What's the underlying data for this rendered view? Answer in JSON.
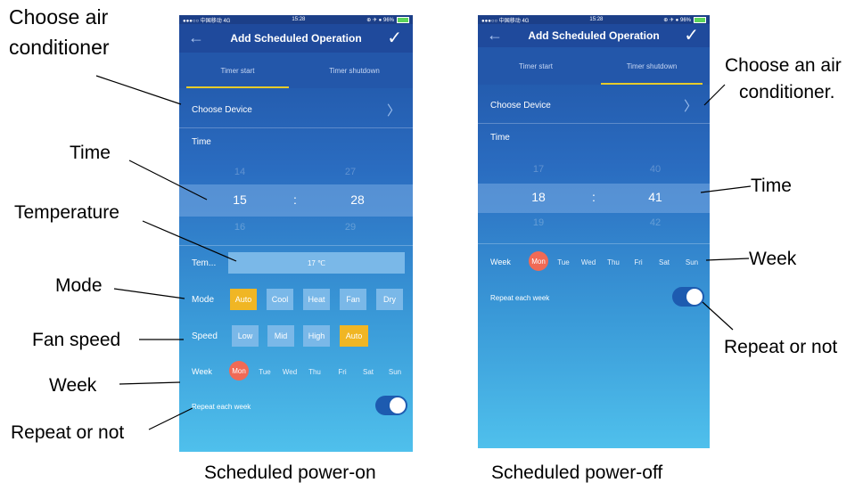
{
  "annotations": {
    "choose_left": "Choose air conditioner",
    "choose_left_l1": "Choose air",
    "choose_left_l2": "conditioner",
    "time_left": "Time",
    "temperature_left": "Temperature",
    "mode_left": "Mode",
    "fan_speed_left": "Fan speed",
    "week_left": "Week",
    "repeat_left": "Repeat or not",
    "choose_right_l1": "Choose an air",
    "choose_right_l2": "conditioner.",
    "time_right": "Time",
    "week_right": "Week",
    "repeat_right": "Repeat or not"
  },
  "captions": {
    "left": "Scheduled power-on",
    "right": "Scheduled power-off"
  },
  "left_screen": {
    "status_left": "●●●○○ 中国移动  4G",
    "status_time": "15:28",
    "status_right": "⊕ ✈ ● 96%",
    "title": "Add Scheduled Operation",
    "tabs": [
      "Timer start",
      "Timer shutdown"
    ],
    "active_tab": 0,
    "choose_device": "Choose Device",
    "time_label": "Time",
    "hour_prev": "14",
    "hour": "15",
    "hour_next": "16",
    "sep": ":",
    "min_prev": "27",
    "min": "28",
    "min_next": "29",
    "temp_label": "Tem...",
    "temp_value": "17 ℃",
    "mode_label": "Mode",
    "modes": [
      "Auto",
      "Cool",
      "Heat",
      "Fan",
      "Dry"
    ],
    "mode_selected": "Auto",
    "speed_label": "Speed",
    "speeds": [
      "Low",
      "Mid",
      "High",
      "Auto"
    ],
    "speed_selected": "Auto",
    "week_label": "Week",
    "days": [
      "Mon",
      "Tue",
      "Wed",
      "Thu",
      "Fri",
      "Sat",
      "Sun"
    ],
    "day_selected": "Mon",
    "repeat_label": "Repeat each week",
    "repeat_on": true
  },
  "right_screen": {
    "status_left": "●●●○○ 中国移动  4G",
    "status_time": "15:28",
    "status_right": "⊕ ✈ ● 96%",
    "title": "Add Scheduled Operation",
    "tabs": [
      "Timer start",
      "Timer shutdown"
    ],
    "active_tab": 1,
    "choose_device": "Choose Device",
    "time_label": "Time",
    "hour_prev": "17",
    "hour": "18",
    "hour_next": "19",
    "sep": ":",
    "min_prev": "40",
    "min": "41",
    "min_next": "42",
    "week_label": "Week",
    "days": [
      "Mon",
      "Tue",
      "Wed",
      "Thu",
      "Fri",
      "Sat",
      "Sun"
    ],
    "day_selected": "Mon",
    "repeat_label": "Repeat each week",
    "repeat_on": true
  },
  "colors": {
    "accent_selected": "#f0b624",
    "day_selected": "#f06a55",
    "tab_underline": "#e6cb2a"
  }
}
